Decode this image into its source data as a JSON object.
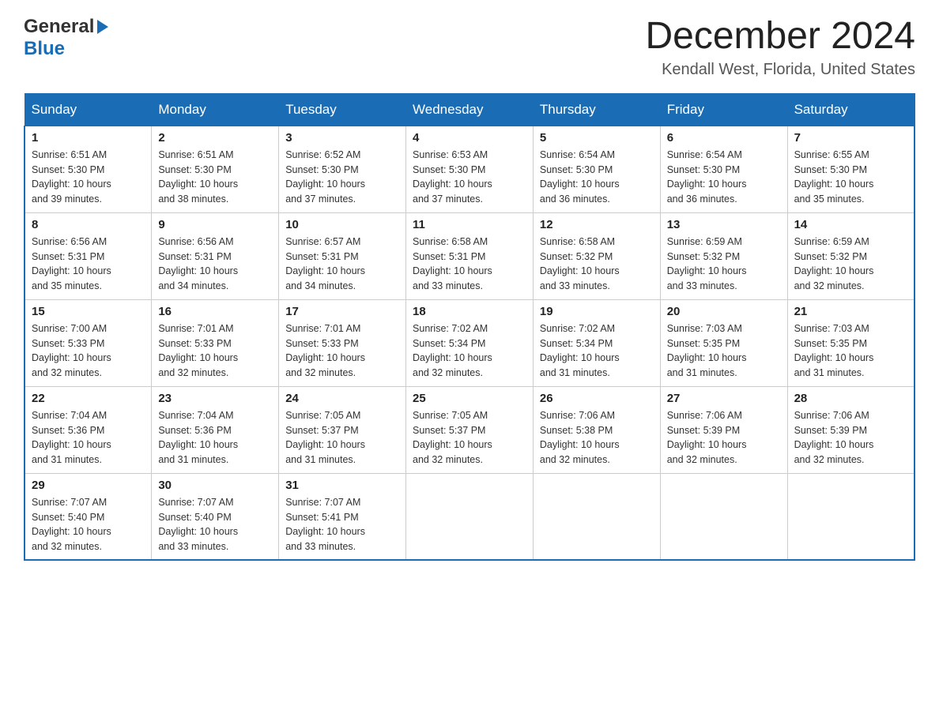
{
  "logo": {
    "general": "General",
    "blue": "Blue"
  },
  "header": {
    "title": "December 2024",
    "subtitle": "Kendall West, Florida, United States"
  },
  "weekdays": [
    "Sunday",
    "Monday",
    "Tuesday",
    "Wednesday",
    "Thursday",
    "Friday",
    "Saturday"
  ],
  "weeks": [
    [
      {
        "day": "1",
        "sunrise": "6:51 AM",
        "sunset": "5:30 PM",
        "daylight": "10 hours and 39 minutes."
      },
      {
        "day": "2",
        "sunrise": "6:51 AM",
        "sunset": "5:30 PM",
        "daylight": "10 hours and 38 minutes."
      },
      {
        "day": "3",
        "sunrise": "6:52 AM",
        "sunset": "5:30 PM",
        "daylight": "10 hours and 37 minutes."
      },
      {
        "day": "4",
        "sunrise": "6:53 AM",
        "sunset": "5:30 PM",
        "daylight": "10 hours and 37 minutes."
      },
      {
        "day": "5",
        "sunrise": "6:54 AM",
        "sunset": "5:30 PM",
        "daylight": "10 hours and 36 minutes."
      },
      {
        "day": "6",
        "sunrise": "6:54 AM",
        "sunset": "5:30 PM",
        "daylight": "10 hours and 36 minutes."
      },
      {
        "day": "7",
        "sunrise": "6:55 AM",
        "sunset": "5:30 PM",
        "daylight": "10 hours and 35 minutes."
      }
    ],
    [
      {
        "day": "8",
        "sunrise": "6:56 AM",
        "sunset": "5:31 PM",
        "daylight": "10 hours and 35 minutes."
      },
      {
        "day": "9",
        "sunrise": "6:56 AM",
        "sunset": "5:31 PM",
        "daylight": "10 hours and 34 minutes."
      },
      {
        "day": "10",
        "sunrise": "6:57 AM",
        "sunset": "5:31 PM",
        "daylight": "10 hours and 34 minutes."
      },
      {
        "day": "11",
        "sunrise": "6:58 AM",
        "sunset": "5:31 PM",
        "daylight": "10 hours and 33 minutes."
      },
      {
        "day": "12",
        "sunrise": "6:58 AM",
        "sunset": "5:32 PM",
        "daylight": "10 hours and 33 minutes."
      },
      {
        "day": "13",
        "sunrise": "6:59 AM",
        "sunset": "5:32 PM",
        "daylight": "10 hours and 33 minutes."
      },
      {
        "day": "14",
        "sunrise": "6:59 AM",
        "sunset": "5:32 PM",
        "daylight": "10 hours and 32 minutes."
      }
    ],
    [
      {
        "day": "15",
        "sunrise": "7:00 AM",
        "sunset": "5:33 PM",
        "daylight": "10 hours and 32 minutes."
      },
      {
        "day": "16",
        "sunrise": "7:01 AM",
        "sunset": "5:33 PM",
        "daylight": "10 hours and 32 minutes."
      },
      {
        "day": "17",
        "sunrise": "7:01 AM",
        "sunset": "5:33 PM",
        "daylight": "10 hours and 32 minutes."
      },
      {
        "day": "18",
        "sunrise": "7:02 AM",
        "sunset": "5:34 PM",
        "daylight": "10 hours and 32 minutes."
      },
      {
        "day": "19",
        "sunrise": "7:02 AM",
        "sunset": "5:34 PM",
        "daylight": "10 hours and 31 minutes."
      },
      {
        "day": "20",
        "sunrise": "7:03 AM",
        "sunset": "5:35 PM",
        "daylight": "10 hours and 31 minutes."
      },
      {
        "day": "21",
        "sunrise": "7:03 AM",
        "sunset": "5:35 PM",
        "daylight": "10 hours and 31 minutes."
      }
    ],
    [
      {
        "day": "22",
        "sunrise": "7:04 AM",
        "sunset": "5:36 PM",
        "daylight": "10 hours and 31 minutes."
      },
      {
        "day": "23",
        "sunrise": "7:04 AM",
        "sunset": "5:36 PM",
        "daylight": "10 hours and 31 minutes."
      },
      {
        "day": "24",
        "sunrise": "7:05 AM",
        "sunset": "5:37 PM",
        "daylight": "10 hours and 31 minutes."
      },
      {
        "day": "25",
        "sunrise": "7:05 AM",
        "sunset": "5:37 PM",
        "daylight": "10 hours and 32 minutes."
      },
      {
        "day": "26",
        "sunrise": "7:06 AM",
        "sunset": "5:38 PM",
        "daylight": "10 hours and 32 minutes."
      },
      {
        "day": "27",
        "sunrise": "7:06 AM",
        "sunset": "5:39 PM",
        "daylight": "10 hours and 32 minutes."
      },
      {
        "day": "28",
        "sunrise": "7:06 AM",
        "sunset": "5:39 PM",
        "daylight": "10 hours and 32 minutes."
      }
    ],
    [
      {
        "day": "29",
        "sunrise": "7:07 AM",
        "sunset": "5:40 PM",
        "daylight": "10 hours and 32 minutes."
      },
      {
        "day": "30",
        "sunrise": "7:07 AM",
        "sunset": "5:40 PM",
        "daylight": "10 hours and 33 minutes."
      },
      {
        "day": "31",
        "sunrise": "7:07 AM",
        "sunset": "5:41 PM",
        "daylight": "10 hours and 33 minutes."
      },
      null,
      null,
      null,
      null
    ]
  ],
  "labels": {
    "sunrise": "Sunrise: ",
    "sunset": "Sunset: ",
    "daylight": "Daylight: "
  }
}
